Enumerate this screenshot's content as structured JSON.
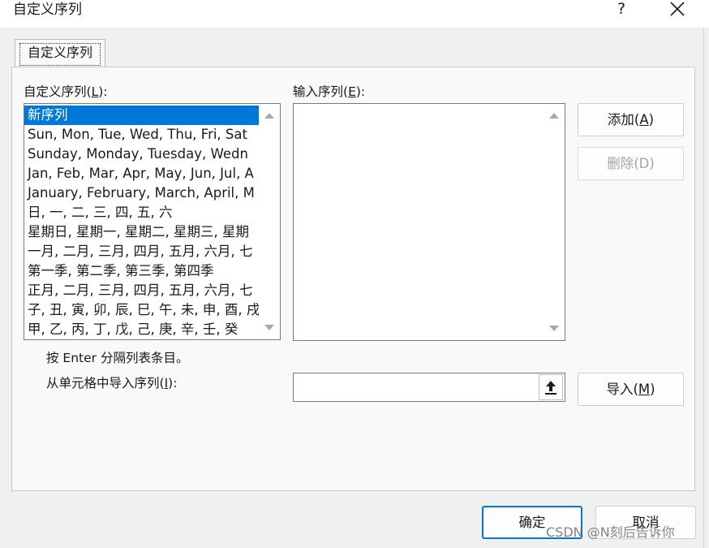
{
  "window": {
    "title": "自定义序列",
    "help_label": "?",
    "close_icon": "close-icon"
  },
  "tab": {
    "label": "自定义序列"
  },
  "custom_lists": {
    "label_prefix": "自定义序列(",
    "label_key": "L",
    "label_suffix": "):",
    "items": [
      "新序列",
      "Sun, Mon, Tue, Wed, Thu, Fri, Sat",
      "Sunday, Monday, Tuesday, Wedn",
      "Jan, Feb, Mar, Apr, May, Jun, Jul, A",
      "January, February, March, April, M",
      "日, 一, 二, 三, 四, 五, 六",
      "星期日, 星期一, 星期二, 星期三, 星期",
      "一月, 二月, 三月, 四月, 五月, 六月, 七",
      "第一季, 第二季, 第三季, 第四季",
      "正月, 二月, 三月, 四月, 五月, 六月, 七",
      "子, 丑, 寅, 卯, 辰, 巳, 午, 未, 申, 酉, 戌",
      "甲, 乙, 丙, 丁, 戊, 己, 庚, 辛, 壬, 癸"
    ],
    "selected_item": "新序列"
  },
  "entries": {
    "label_prefix": "输入序列(",
    "label_key": "E",
    "label_suffix": "):",
    "value": ""
  },
  "buttons": {
    "add_prefix": "添加(",
    "add_key": "A",
    "add_suffix": ")",
    "delete": "删除(D)",
    "import_prefix": "导入(",
    "import_key": "M",
    "import_suffix": ")",
    "ok": "确定",
    "cancel": "取消"
  },
  "hint": "按 Enter 分隔列表条目。",
  "import_cells": {
    "label_prefix": "从单元格中导入序列(",
    "label_key": "I",
    "label_suffix": "):",
    "value": ""
  },
  "watermark": "CSDN @N刻后告诉你"
}
